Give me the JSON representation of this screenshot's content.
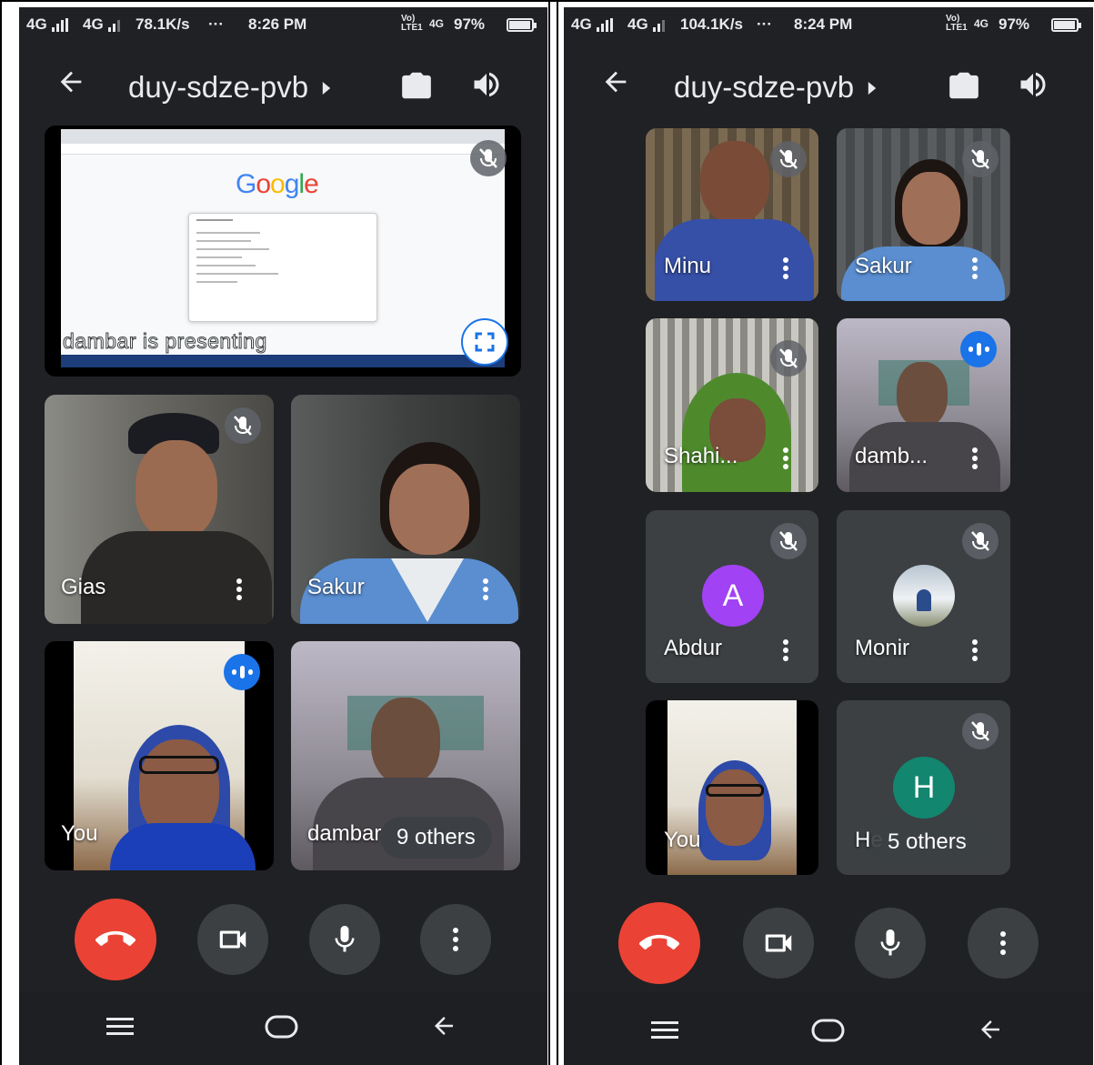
{
  "left_phone": {
    "status": {
      "net1": "4G",
      "net2": "4G",
      "speed": "78.1K/s",
      "more": "···",
      "time": "8:26 PM",
      "volte": "Vo) LTE1",
      "net4g": "4G",
      "battery": "97%"
    },
    "meeting_code": "duy-sdze-pvb",
    "presentation_label": "dambar is presenting",
    "google_logo": "Google",
    "tiles": [
      {
        "name": "Gias"
      },
      {
        "name": "Sakur"
      },
      {
        "name": "You"
      },
      {
        "name": "dambar"
      }
    ],
    "others_label": "9 others"
  },
  "right_phone": {
    "status": {
      "net1": "4G",
      "net2": "4G",
      "speed": "104.1K/s",
      "more": "···",
      "time": "8:24 PM",
      "volte": "Vo) LTE1",
      "net4g": "4G",
      "battery": "97%"
    },
    "meeting_code": "duy-sdze-pvb",
    "tiles": [
      {
        "name": "Minu"
      },
      {
        "name": "Sakur"
      },
      {
        "name": "Shahi..."
      },
      {
        "name": "damb..."
      },
      {
        "name": "Abdur",
        "avatar_letter": "A",
        "avatar_color": "#a142f4"
      },
      {
        "name": "Monir"
      },
      {
        "name": "You"
      },
      {
        "name": "He",
        "avatar_letter": "H",
        "avatar_color": "#12866f"
      }
    ],
    "others_label": "5 others"
  },
  "colors": {
    "background": "#202124",
    "tile": "#3c4043",
    "end_call": "#ea4335",
    "accent": "#1a73e8"
  },
  "icons": [
    "back-arrow-icon",
    "arrow-right-icon",
    "camera-flip-icon",
    "speaker-icon",
    "mic-off-icon",
    "speaking-icon",
    "fullscreen-icon",
    "end-call-icon",
    "video-camera-icon",
    "mic-icon",
    "more-vert-icon",
    "menu-icon",
    "home-icon",
    "nav-back-icon"
  ]
}
